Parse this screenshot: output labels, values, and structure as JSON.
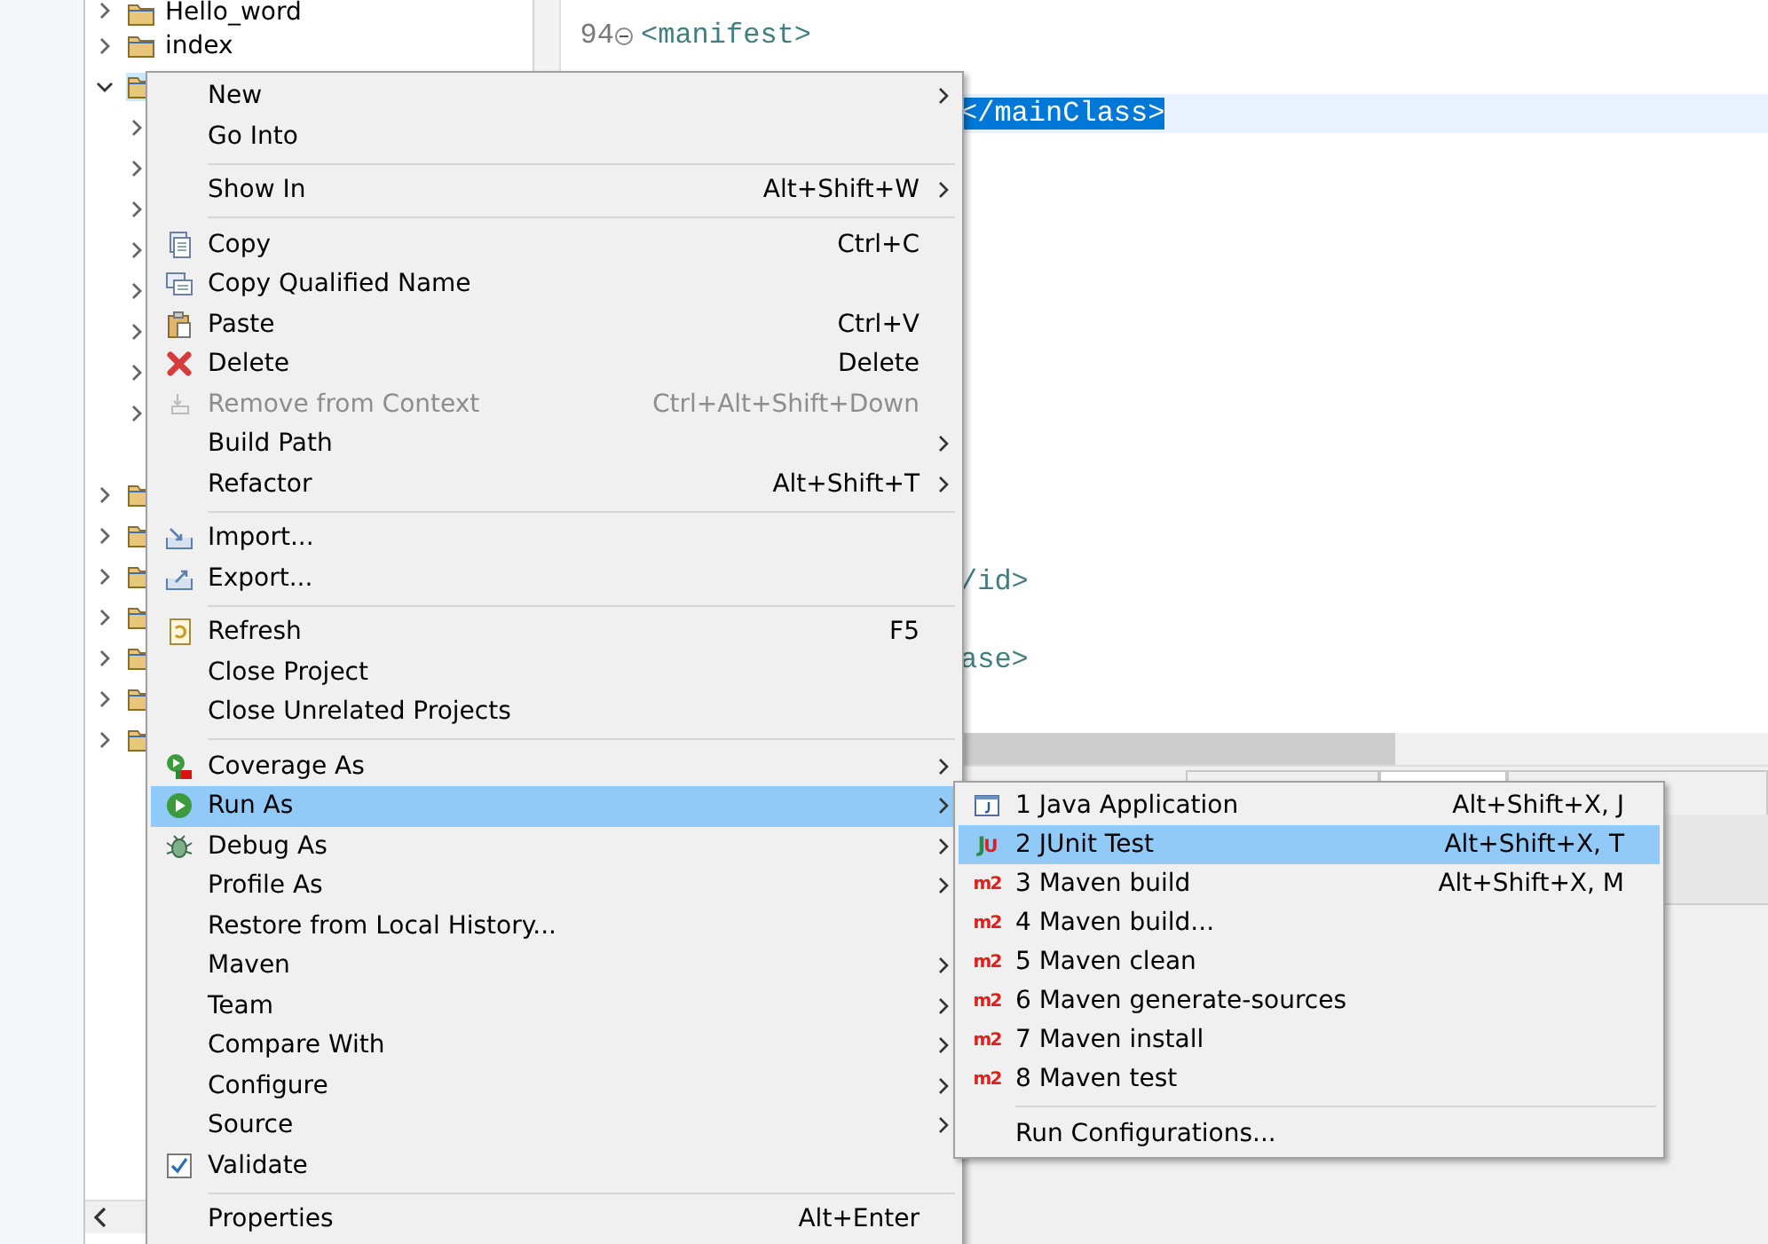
{
  "project_tree": {
    "items": [
      {
        "label": "Hello_word",
        "expanded": false,
        "selected": false
      },
      {
        "label": "index",
        "expanded": false,
        "selected": false
      },
      {
        "expanded": true,
        "selected": true,
        "children": [
          {
            "expanded": false
          },
          {
            "expanded": false
          },
          {
            "expanded": false
          },
          {
            "expanded": false
          },
          {
            "expanded": false
          },
          {
            "expanded": false
          },
          {
            "expanded": false
          },
          {
            "expanded": false
          }
        ]
      },
      {
        "expanded": false,
        "selected": false
      },
      {
        "expanded": false,
        "selected": false
      },
      {
        "expanded": false,
        "selected": false
      },
      {
        "expanded": false,
        "selected": false
      },
      {
        "expanded": false,
        "selected": false
      },
      {
        "expanded": false,
        "selected": false
      },
      {
        "expanded": false,
        "selected": false
      }
    ]
  },
  "editor": {
    "lines": [
      {
        "number": "94",
        "text": "<manifest>",
        "foldable": true,
        "selected": false
      },
      {
        "text": "</mainClass>",
        "selected": true
      },
      {
        "text": "/id>",
        "selected": false
      },
      {
        "text": "ase>",
        "selected": false
      }
    ],
    "view_tabs": [
      {
        "selected": false
      },
      {
        "selected": true
      },
      {
        "selected": false
      }
    ]
  },
  "context_menu": {
    "items": [
      {
        "kind": "item",
        "label": "New",
        "submenu": true,
        "disabled": false,
        "selected": false,
        "checked": false
      },
      {
        "kind": "item",
        "label": "Go Into",
        "submenu": false,
        "disabled": false,
        "selected": false,
        "checked": false
      },
      {
        "kind": "separator"
      },
      {
        "kind": "item",
        "label": "Show In",
        "shortcut": "Alt+Shift+W",
        "submenu": true,
        "disabled": false,
        "selected": false,
        "checked": false
      },
      {
        "kind": "separator"
      },
      {
        "kind": "item",
        "label": "Copy",
        "shortcut": "Ctrl+C",
        "submenu": false,
        "disabled": false,
        "selected": false,
        "checked": false
      },
      {
        "kind": "item",
        "label": "Copy Qualified Name",
        "submenu": false,
        "disabled": false,
        "selected": false,
        "checked": false
      },
      {
        "kind": "item",
        "label": "Paste",
        "shortcut": "Ctrl+V",
        "submenu": false,
        "disabled": false,
        "selected": false,
        "checked": false
      },
      {
        "kind": "item",
        "label": "Delete",
        "shortcut": "Delete",
        "submenu": false,
        "disabled": false,
        "selected": false,
        "checked": false
      },
      {
        "kind": "item",
        "label": "Remove from Context",
        "shortcut": "Ctrl+Alt+Shift+Down",
        "submenu": false,
        "disabled": true,
        "selected": false,
        "checked": false
      },
      {
        "kind": "item",
        "label": "Build Path",
        "submenu": true,
        "disabled": false,
        "selected": false,
        "checked": false
      },
      {
        "kind": "item",
        "label": "Refactor",
        "shortcut": "Alt+Shift+T",
        "submenu": true,
        "disabled": false,
        "selected": false,
        "checked": false
      },
      {
        "kind": "separator"
      },
      {
        "kind": "item",
        "label": "Import...",
        "submenu": false,
        "disabled": false,
        "selected": false,
        "checked": false
      },
      {
        "kind": "item",
        "label": "Export...",
        "submenu": false,
        "disabled": false,
        "selected": false,
        "checked": false
      },
      {
        "kind": "separator"
      },
      {
        "kind": "item",
        "label": "Refresh",
        "shortcut": "F5",
        "submenu": false,
        "disabled": false,
        "selected": false,
        "checked": false
      },
      {
        "kind": "item",
        "label": "Close Project",
        "submenu": false,
        "disabled": false,
        "selected": false,
        "checked": false
      },
      {
        "kind": "item",
        "label": "Close Unrelated Projects",
        "submenu": false,
        "disabled": false,
        "selected": false,
        "checked": false
      },
      {
        "kind": "separator"
      },
      {
        "kind": "item",
        "label": "Coverage As",
        "submenu": true,
        "disabled": false,
        "selected": false,
        "checked": false
      },
      {
        "kind": "item",
        "label": "Run As",
        "submenu": true,
        "disabled": false,
        "selected": true,
        "checked": false
      },
      {
        "kind": "item",
        "label": "Debug As",
        "submenu": true,
        "disabled": false,
        "selected": false,
        "checked": false
      },
      {
        "kind": "item",
        "label": "Profile As",
        "submenu": true,
        "disabled": false,
        "selected": false,
        "checked": false
      },
      {
        "kind": "item",
        "label": "Restore from Local History...",
        "submenu": false,
        "disabled": false,
        "selected": false,
        "checked": false
      },
      {
        "kind": "item",
        "label": "Maven",
        "submenu": true,
        "disabled": false,
        "selected": false,
        "checked": false
      },
      {
        "kind": "item",
        "label": "Team",
        "submenu": true,
        "disabled": false,
        "selected": false,
        "checked": false
      },
      {
        "kind": "item",
        "label": "Compare With",
        "submenu": true,
        "disabled": false,
        "selected": false,
        "checked": false
      },
      {
        "kind": "item",
        "label": "Configure",
        "submenu": true,
        "disabled": false,
        "selected": false,
        "checked": false
      },
      {
        "kind": "item",
        "label": "Source",
        "submenu": true,
        "disabled": false,
        "selected": false,
        "checked": false
      },
      {
        "kind": "item",
        "label": "Validate",
        "submenu": false,
        "disabled": false,
        "selected": false,
        "checked": true
      },
      {
        "kind": "separator"
      },
      {
        "kind": "item",
        "label": "Properties",
        "shortcut": "Alt+Enter",
        "submenu": false,
        "disabled": false,
        "selected": false,
        "checked": false
      }
    ]
  },
  "run_as_submenu": {
    "items": [
      {
        "kind": "item",
        "label": "1 Java Application",
        "shortcut": "Alt+Shift+X, J",
        "selected": false
      },
      {
        "kind": "item",
        "label": "2 JUnit Test",
        "shortcut": "Alt+Shift+X, T",
        "selected": true,
        "icon_text": "JU"
      },
      {
        "kind": "item",
        "label": "3 Maven build",
        "shortcut": "Alt+Shift+X, M",
        "selected": false,
        "icon_text": "m2"
      },
      {
        "kind": "item",
        "label": "4 Maven build...",
        "selected": false,
        "icon_text": "m2"
      },
      {
        "kind": "item",
        "label": "5 Maven clean",
        "selected": false,
        "icon_text": "m2"
      },
      {
        "kind": "item",
        "label": "6 Maven generate-sources",
        "selected": false,
        "icon_text": "m2"
      },
      {
        "kind": "item",
        "label": "7 Maven install",
        "selected": false,
        "icon_text": "m2"
      },
      {
        "kind": "item",
        "label": "8 Maven test",
        "selected": false,
        "icon_text": "m2"
      },
      {
        "kind": "separator"
      },
      {
        "kind": "item",
        "label": "Run Configurations...",
        "selected": false
      }
    ]
  }
}
